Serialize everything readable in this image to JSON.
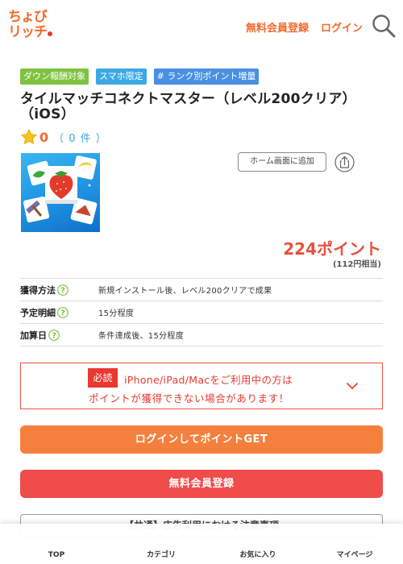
{
  "header": {
    "logo_line1": "ちょび",
    "logo_line2": "リッチ",
    "register_label": "無料会員登録",
    "login_label": "ログイン"
  },
  "badges": [
    "ダウン報酬対象",
    "スマホ限定",
    "# ランク別ポイント増量"
  ],
  "offer": {
    "title": "タイルマッチコネクトマスター（レベル200クリア）（iOS）",
    "rating_value": "0",
    "rating_count": "（ 0 件 ）",
    "home_button_label": "ホーム画面に追加",
    "points": "224ポイント",
    "points_yen": "(112円相当)"
  },
  "info": [
    {
      "label": "獲得方法",
      "value": "新規インストール後、レベル200クリアで成果"
    },
    {
      "label": "予定明細",
      "value": "15分程度"
    },
    {
      "label": "加算日",
      "value": "条件達成後、15分程度"
    }
  ],
  "notice": {
    "tag": "必読",
    "line1": "iPhone/iPad/Macをご利用中の方は",
    "line2": "ポイントが獲得できない場合があります！"
  },
  "buttons": {
    "login_get": "ログインしてポイントGET",
    "register": "無料会員登録"
  },
  "caution_title": "【共通】広告利用における注意事項",
  "nav": [
    "TOP",
    "カテゴリ",
    "お気に入り",
    "マイページ"
  ],
  "colors": {
    "brand_orange": "#f26a2e",
    "accent_red": "#e8382f",
    "badge_green": "#7fc241",
    "badge_blue": "#3ea8e5"
  }
}
